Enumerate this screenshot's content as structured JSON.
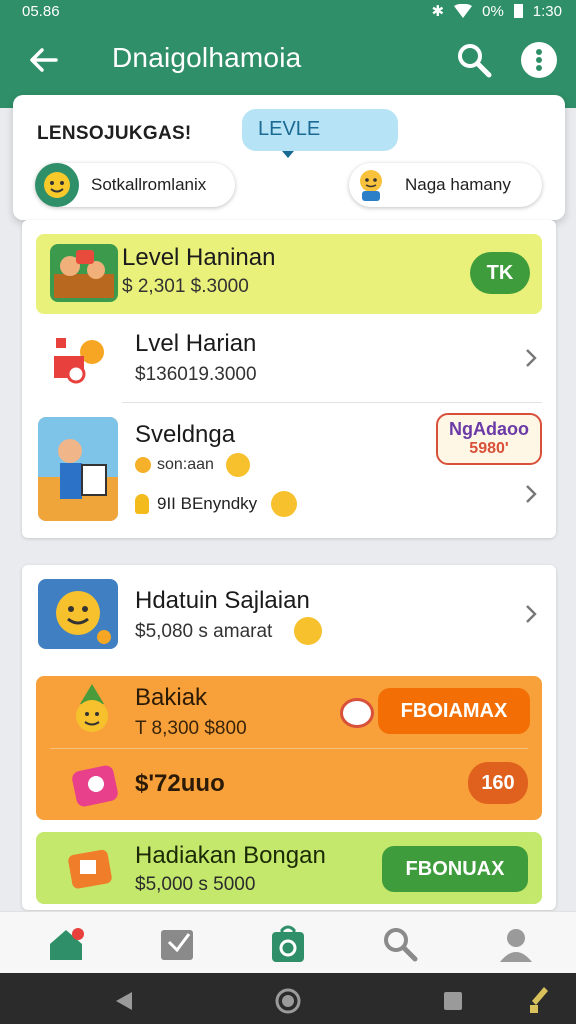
{
  "status_bar": {
    "time_left": "05.86",
    "battery": "0%",
    "time_right": "1:30"
  },
  "app_bar": {
    "title": "Dnaigolhamoia",
    "back_icon": "arrow-left-icon",
    "search_icon": "search-icon",
    "more_icon": "more-vert-icon"
  },
  "header": {
    "label": "LENSOJUKGAS!",
    "level_pill": "LEVLE",
    "chip_left": "Sotkallromlanix",
    "chip_right": "Naga hamany"
  },
  "list1": [
    {
      "name": "Level Haninan",
      "price": "$ 2,301 $.3000",
      "badge": "TK"
    },
    {
      "name": "Lvel Harian",
      "price": "$136019.3000"
    },
    {
      "name": "Sveldnga",
      "sub": "son:aan",
      "note": "9II BEnyndky",
      "promo": "NgAdaoo",
      "promo_price": "5980'"
    }
  ],
  "list2": [
    {
      "name": "Hdatuin Sajlaian",
      "price": "$5,080 s amarat"
    },
    {
      "name": "Bakiak",
      "price": "T 8,300 $800",
      "button": "FBOIAMAX"
    },
    {
      "name": "$'72uuo",
      "badge": "160"
    },
    {
      "name": "Hadiakan Bongan",
      "price": "$5,000 s 5000",
      "button": "FBONUAX"
    }
  ],
  "colors": {
    "brand": "#2f8f68",
    "yellow_row": "#e9f17a",
    "orange_row": "#f8a13a",
    "lime_row": "#c4e86b",
    "button_green": "#3f9c3c",
    "button_orange": "#f36f06"
  },
  "bottom_nav": [
    "home-icon",
    "bookmark-icon",
    "shop-bag-icon",
    "search-people-icon",
    "profile-icon"
  ]
}
